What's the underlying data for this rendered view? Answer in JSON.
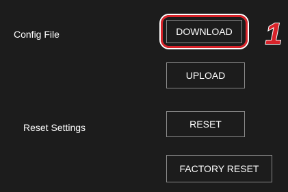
{
  "config_file": {
    "label": "Config File",
    "download_label": "DOWNLOAD",
    "upload_label": "UPLOAD"
  },
  "reset_settings": {
    "label": "Reset Settings",
    "reset_label": "RESET",
    "factory_reset_label": "FACTORY RESET"
  },
  "callout": {
    "step_number": "1",
    "highlight_color": "#d8232a"
  }
}
